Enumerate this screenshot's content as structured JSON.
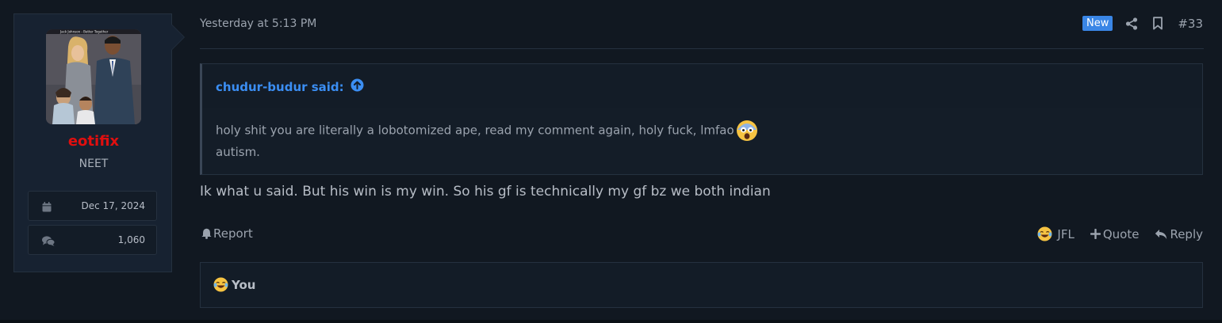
{
  "user": {
    "name": "eotifix",
    "title": "NEET",
    "avatar_caption": "Jack Johnson - Better Together",
    "joined": "Dec 17, 2024",
    "messages": "1,060",
    "name_color": "#e00f0f"
  },
  "post": {
    "date": "Yesterday at 5:13 PM",
    "badge": "New",
    "number": "#33",
    "quote": {
      "author": "chudur-budur said:",
      "line1": "holy shit you are literally a lobotomized ape, read my comment again, holy fuck, lmfao",
      "line2": "autism."
    },
    "message": "Ik what u said. But his win is my win. So his gf is technically my gf bz we both indian",
    "actions": {
      "report": "Report",
      "reaction": "JFL",
      "quote": "Quote",
      "reply": "Reply"
    },
    "reactions_bar": {
      "label": "You"
    }
  },
  "colors": {
    "accent": "#3b8ef3",
    "badge": "#3a86e6",
    "background": "#111821",
    "panel": "#172231"
  },
  "icons": [
    "calendar-icon",
    "comments-icon",
    "share-icon",
    "bookmark-icon",
    "arrow-up-circle-icon",
    "bell-icon",
    "plus-icon",
    "reply-icon",
    "laughing-emoji-icon",
    "shocked-emoji-icon"
  ]
}
